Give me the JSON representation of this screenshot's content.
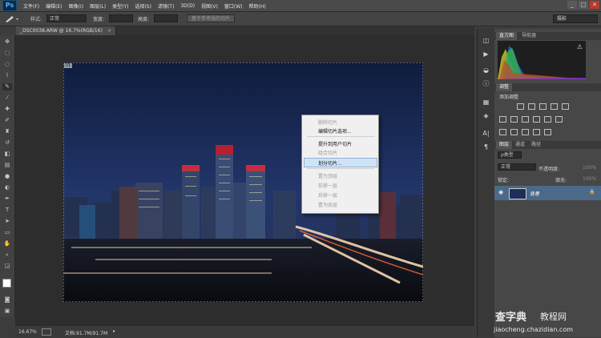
{
  "app": {
    "logo": "Ps"
  },
  "menubar": {
    "items": [
      "文件(F)",
      "编辑(E)",
      "图像(I)",
      "图层(L)",
      "类型(Y)",
      "选择(S)",
      "滤镜(T)",
      "3D(D)",
      "视图(V)",
      "窗口(W)",
      "帮助(H)"
    ],
    "win_controls": [
      "_",
      "□",
      "✕"
    ]
  },
  "options_bar": {
    "style_label": "样式:",
    "style_value": "正常",
    "width_label": "宽度:",
    "height_label": "高度:",
    "guides_button": "基于参考线的切片",
    "workspace": "摄影"
  },
  "document": {
    "tab_title": "_DSC0038.ARW @ 16.7%(RGB/16)",
    "slice_badge": "01"
  },
  "context_menu": {
    "items": [
      {
        "label": "删除切片",
        "enabled": false
      },
      {
        "label": "编辑切片选项...",
        "enabled": true
      },
      {
        "label": "提升到用户切片",
        "enabled": true
      },
      {
        "label": "组合切片",
        "enabled": false
      },
      {
        "label": "划分切片...",
        "enabled": true,
        "highlighted": true
      },
      {
        "label": "置为顶层",
        "enabled": false
      },
      {
        "label": "前移一层",
        "enabled": false
      },
      {
        "label": "后移一层",
        "enabled": false
      },
      {
        "label": "置为底层",
        "enabled": false
      }
    ]
  },
  "status": {
    "zoom": "16.67%",
    "doc_info": "文档:91.7M/91.7M"
  },
  "panels": {
    "histogram_tabs": [
      "直方图",
      "导航器"
    ],
    "adjust_tab": "调整",
    "adjust_title": "添加调整",
    "layer_tabs": [
      "图层",
      "通道",
      "路径"
    ],
    "filter_kind": "ρ类型",
    "blend_mode": "正常",
    "opacity_label": "不透明度:",
    "opacity_value": "100%",
    "lock_label": "锁定:",
    "fill_label": "填充:",
    "fill_value": "100%",
    "layer_name": "背景"
  },
  "watermark": {
    "brand": "查字典",
    "section": "教程网",
    "url": "jiaocheng.chazidian.com"
  },
  "colors": {
    "menu_bg": "#4a4a4a",
    "panel_bg": "#474747",
    "canvas_bg": "#2d2d2d",
    "accent_blue": "#4fb3ff",
    "layer_selected": "#4b6a8a",
    "ctx_highlight": "#cfe3f6"
  }
}
